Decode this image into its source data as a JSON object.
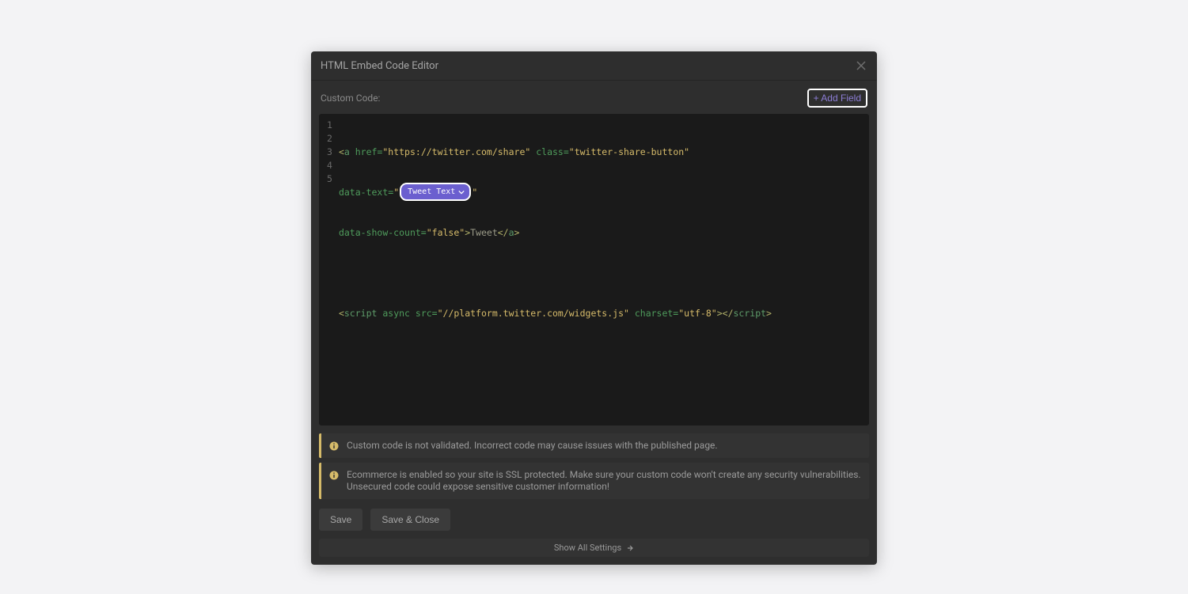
{
  "modal": {
    "title": "HTML Embed Code Editor",
    "custom_code_label": "Custom Code:",
    "add_field_label": "+ Add Field"
  },
  "code": {
    "line_numbers": [
      "1",
      "2",
      "3",
      "4",
      "5"
    ],
    "line1": {
      "lt": "<",
      "tag": "a",
      "attr1_name": " href=",
      "attr1_val": "\"https://twitter.com/share\"",
      "attr2_name": " class=",
      "attr2_val": "\"twitter-share-button\""
    },
    "line2": {
      "attr_name": "data-text=",
      "quote1": "\"",
      "chip_label": "Tweet Text",
      "quote2": "\""
    },
    "line3": {
      "attr_name": "data-show-count=",
      "attr_val": "\"false\"",
      "gt": ">",
      "text": "Tweet",
      "close_lt": "</",
      "close_tag": "a",
      "close_gt": ">"
    },
    "line5": {
      "lt": "<",
      "tag": "script",
      "async": " async",
      "src_name": " src=",
      "src_val": "\"//platform.twitter.com/widgets.js\"",
      "charset_name": " charset=",
      "charset_val": "\"utf-8\"",
      "gt": ">",
      "close_lt": "</",
      "close_tag": "script",
      "close_gt": ">"
    }
  },
  "notices": {
    "notice1": "Custom code is not validated. Incorrect code may cause issues with the published page.",
    "notice2": "Ecommerce is enabled so your site is SSL protected. Make sure your custom code won't create any security vulnerabilities. Unsecured code could expose sensitive customer information!"
  },
  "buttons": {
    "save": "Save",
    "save_close": "Save & Close",
    "show_all": "Show All Settings"
  }
}
